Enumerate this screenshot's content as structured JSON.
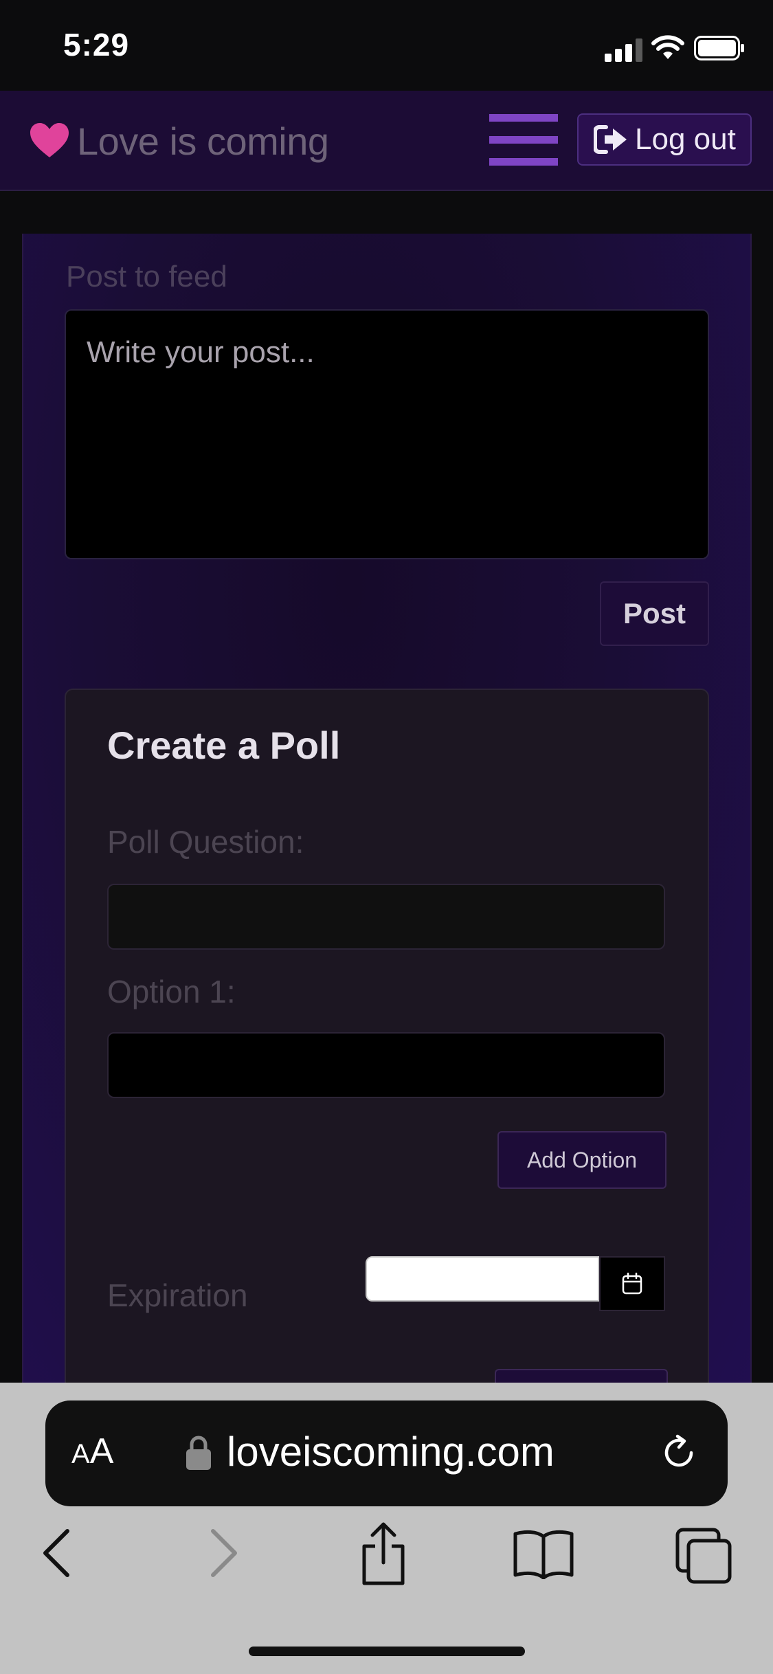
{
  "status_bar": {
    "time": "5:29"
  },
  "navbar": {
    "brand": "Love is coming",
    "logout_label": "Log out",
    "accent_color": "#e0439b"
  },
  "post": {
    "label": "Post to feed",
    "placeholder": "Write your post...",
    "button": "Post"
  },
  "poll": {
    "title": "Create a Poll",
    "question_label": "Poll Question:",
    "question_value": "",
    "option1_label": "Option 1:",
    "option1_value": "",
    "add_option": "Add Option",
    "expiration_label": "Expiration",
    "expiration_value": ""
  },
  "browser": {
    "text_size_big": "A",
    "text_size_small": "A",
    "url": "loveiscoming.com"
  }
}
